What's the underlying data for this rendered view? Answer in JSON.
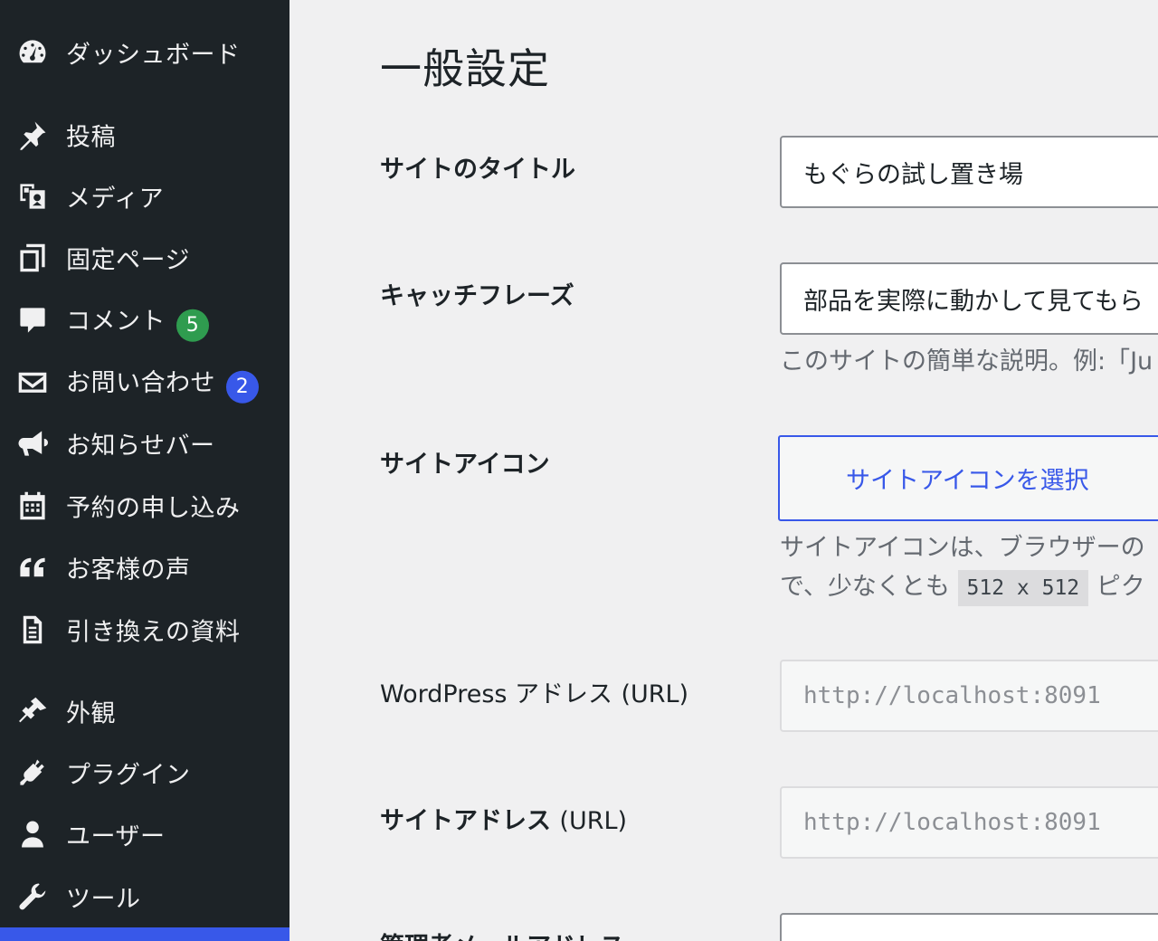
{
  "sidebar": {
    "items": [
      {
        "label": "ダッシュボード",
        "icon": "dashboard-icon"
      },
      {
        "label": "投稿",
        "icon": "pushpin-icon"
      },
      {
        "label": "メディア",
        "icon": "media-icon"
      },
      {
        "label": "固定ページ",
        "icon": "pages-icon"
      },
      {
        "label": "コメント",
        "icon": "comment-icon",
        "badge": "5"
      },
      {
        "label": "お問い合わせ",
        "icon": "envelope-icon",
        "badge": "2"
      },
      {
        "label": "お知らせバー",
        "icon": "megaphone-icon"
      },
      {
        "label": "予約の申し込み",
        "icon": "calendar-icon"
      },
      {
        "label": "お客様の声",
        "icon": "quote-icon"
      },
      {
        "label": "引き換えの資料",
        "icon": "document-icon"
      },
      {
        "label": "外観",
        "icon": "paintbrush-icon"
      },
      {
        "label": "プラグイン",
        "icon": "plugin-icon"
      },
      {
        "label": "ユーザー",
        "icon": "user-icon"
      },
      {
        "label": "ツール",
        "icon": "wrench-icon"
      }
    ],
    "colors": {
      "background": "#1d2327",
      "current": "#3858e9",
      "badge_green": "#2f9c4f",
      "badge_blue": "#3858e9"
    }
  },
  "main": {
    "title": "一般設定",
    "site_title": {
      "label": "サイトのタイトル",
      "value": "もぐらの試し置き場"
    },
    "tagline": {
      "label": "キャッチフレーズ",
      "value": "部品を実際に動かして見てもら",
      "description": "このサイトの簡単な説明。例:「Ju"
    },
    "site_icon": {
      "label": "サイトアイコン",
      "button": "サイトアイコンを選択",
      "description_line1": "サイトアイコンは、ブラウザーの",
      "description_line2_prefix": "で、少なくとも",
      "description_code": "512 x 512",
      "description_line2_suffix": "ピク"
    },
    "wp_address": {
      "label_prefix": "WordPress アドレス",
      "label_suffix": "(URL)",
      "value": "http://localhost:8091"
    },
    "site_address": {
      "label_prefix": "サイトアドレス",
      "label_suffix": "(URL)",
      "value": "http://localhost:8091"
    },
    "admin_email": {
      "label": "管理者メールアドレス"
    },
    "accent_color": "#3858e9"
  }
}
